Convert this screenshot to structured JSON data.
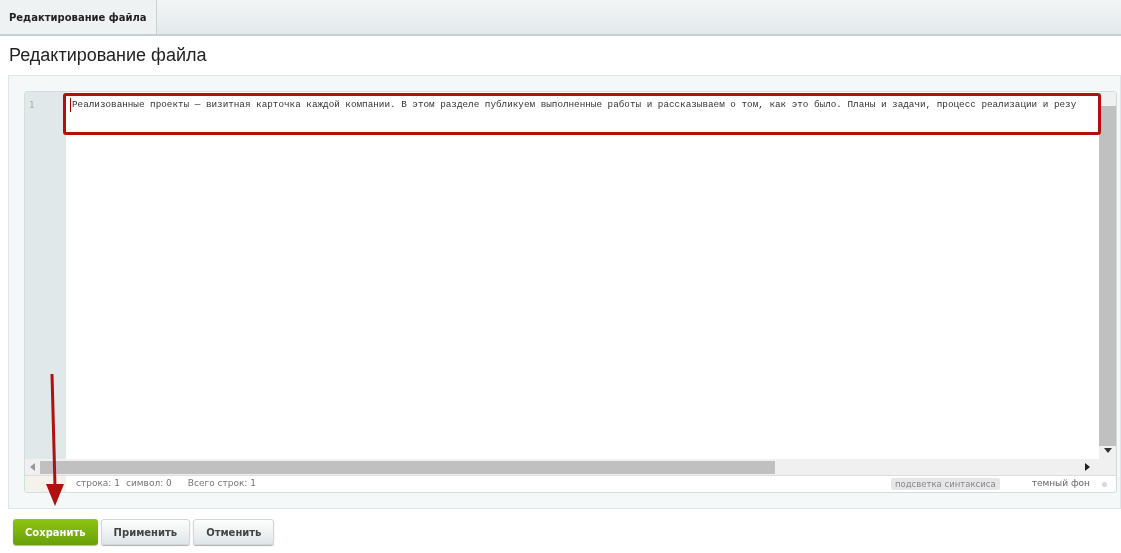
{
  "tabs": [
    {
      "label": "Редактирование файла",
      "selected": true
    }
  ],
  "title": "Редактирование файла",
  "editor": {
    "lines": [
      {
        "number": "1",
        "text": "Реализованные проекты — визитная карточка каждой компании. В этом разделе публикуем выполненные работы и рассказываем о том, как это было. Планы и задачи, процесс реализации и резу"
      }
    ]
  },
  "status_bar": {
    "items": [
      "строка: 1",
      "символ: 0",
      "Всего строк: 1"
    ],
    "syntax_highlight": {
      "label": "подсветка синтаксиса",
      "on": true
    },
    "dark_background": {
      "label": "темный фон",
      "on": false
    }
  },
  "buttons": [
    {
      "label": "Сохранить",
      "kind": "primary"
    },
    {
      "label": "Применить",
      "kind": "secondary"
    },
    {
      "label": "Отменить",
      "kind": "secondary"
    }
  ]
}
